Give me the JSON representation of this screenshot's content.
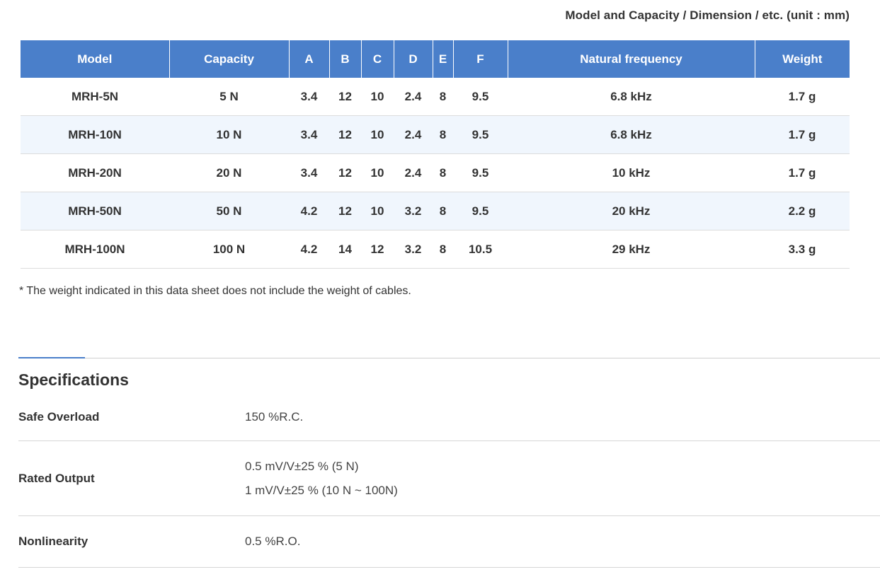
{
  "caption": "Model and Capacity / Dimension / etc. (unit : mm)",
  "table": {
    "headers": [
      "Model",
      "Capacity",
      "A",
      "B",
      "C",
      "D",
      "E",
      "F",
      "Natural frequency",
      "Weight"
    ],
    "rows": [
      [
        "MRH-5N",
        "5 N",
        "3.4",
        "12",
        "10",
        "2.4",
        "8",
        "9.5",
        "6.8 kHz",
        "1.7 g"
      ],
      [
        "MRH-10N",
        "10 N",
        "3.4",
        "12",
        "10",
        "2.4",
        "8",
        "9.5",
        "6.8 kHz",
        "1.7 g"
      ],
      [
        "MRH-20N",
        "20 N",
        "3.4",
        "12",
        "10",
        "2.4",
        "8",
        "9.5",
        "10 kHz",
        "1.7 g"
      ],
      [
        "MRH-50N",
        "50 N",
        "4.2",
        "12",
        "10",
        "3.2",
        "8",
        "9.5",
        "20 kHz",
        "2.2 g"
      ],
      [
        "MRH-100N",
        "100 N",
        "4.2",
        "14",
        "12",
        "3.2",
        "8",
        "10.5",
        "29 kHz",
        "3.3 g"
      ]
    ]
  },
  "note": "* The weight indicated in this data sheet does not include the weight of cables.",
  "specifications": {
    "title": "Specifications",
    "items": [
      {
        "label": "Safe Overload",
        "values": [
          "150 %R.C."
        ]
      },
      {
        "label": "Rated Output",
        "values": [
          "0.5 mV/V±25 % (5 N)",
          "1 mV/V±25 % (10 N ~ 100N)"
        ]
      },
      {
        "label": "Nonlinearity",
        "values": [
          "0.5 %R.O."
        ]
      }
    ]
  },
  "colors": {
    "header_bg": "#4a7fca",
    "alt_row_bg": "#f0f6fd"
  }
}
